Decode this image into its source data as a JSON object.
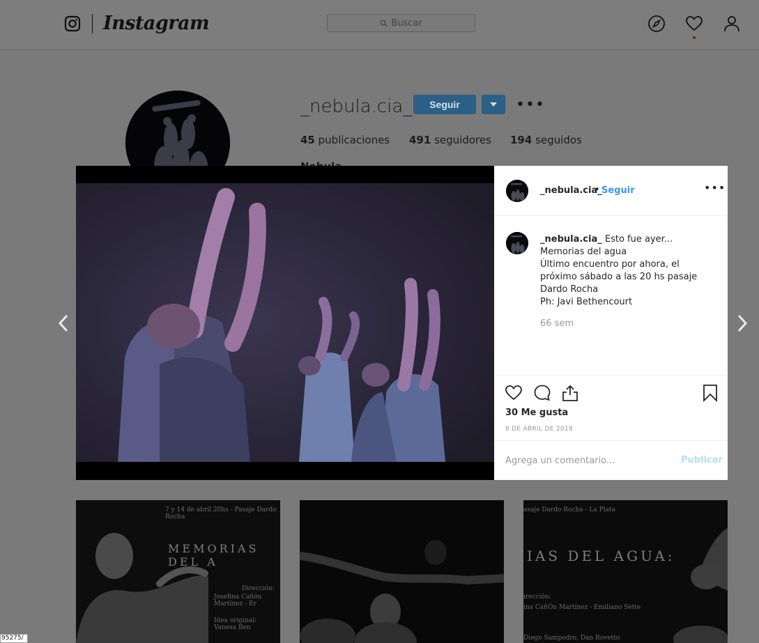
{
  "nav": {
    "wordmark": "Instagram",
    "search_placeholder": "Buscar",
    "icons": [
      "instagram-glyph-icon",
      "compass-icon",
      "heart-icon",
      "user-icon",
      "search-icon"
    ]
  },
  "profile": {
    "username": "_nebula.cia_",
    "follow_label": "Seguir",
    "more_label": "•••",
    "bio_name": "Nebula",
    "stats": [
      {
        "count": "45",
        "label": "publicaciones"
      },
      {
        "count": "491",
        "label": "seguidores"
      },
      {
        "count": "194",
        "label": "seguidos"
      }
    ]
  },
  "post": {
    "username": "_nebula.cia_",
    "separator": "•",
    "follow_label": "Seguir",
    "more_label": "•••",
    "caption_lines": [
      "Esto fue ayer...",
      "Memorias del agua",
      "Último encuentro por ahora, el próximo sábado a las 20 hs pasaje Dardo Rocha",
      "Ph: Javi Bethencourt"
    ],
    "time_ago": "66 sem",
    "likes": "30 Me gusta",
    "date": "8 DE ABRIL DE 2018",
    "comment_placeholder": "Agrega un comentario...",
    "publish_label": "Publicar"
  },
  "grid": {
    "thumb1": {
      "header": "7 y 14 de abril 20hs - Pasaje Dardo Rocha",
      "title": "MEMORIAS DEL A",
      "credit_label": "Dirección:",
      "credit_names": "Josefina Cañón Martínez - Er",
      "idea": "Idea original: Vanesa Ben"
    },
    "thumb3": {
      "header": "asaje Dardo Rocha - La Plata",
      "title": "IAS DEL AGUA:",
      "credit_label": "irección:",
      "credit_names": "ina CañÓn Martínez - Emiliano Sette",
      "extra": "Diego Sampedro, Dan Rovetto"
    }
  },
  "corner_tag": "95275/",
  "colors": {
    "link_blue": "#3897f0",
    "follow_button": "#3897f0",
    "publish_disabled": "#b2dffc"
  }
}
